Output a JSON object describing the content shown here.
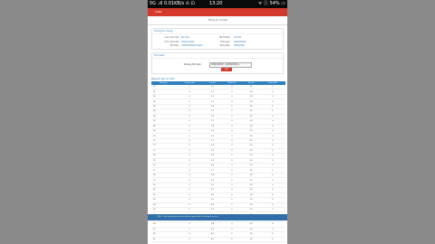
{
  "status": {
    "left": "5G .ıll 0.01KB/s ⊙ ⊡",
    "time": "13:20",
    "right": "ᯤ ⓘ 54% ▭"
  },
  "app": {
    "title": "CSDL"
  },
  "subtitle": "Thông tin chi tiết",
  "info": {
    "title": "Thông tin chung",
    "rows": [
      {
        "k1": "Loại cảm biến:",
        "v1": "Đo mưa",
        "k2": "Mã tỉnh/tp:",
        "v2": "XX XXX"
      },
      {
        "k1": "Vị trí cảm biến:",
        "v1": "XXXXX XXXX",
        "k2": "Thời gian:",
        "v2": "XX/XX/XXXX"
      },
      {
        "k1": "Tên trạm:",
        "v1": "XXXXXXXXXXX XXXX",
        "k2": "Trạng thái:",
        "v2": "XXXXXXXX"
      }
    ]
  },
  "filter": {
    "title": "Tìm kiếm",
    "label": "Khoảng thời gian:",
    "select": "XX/XX/XXXX - XX/XX/XXXX ▾",
    "button": "Lọc"
  },
  "table": {
    "title": "Bảng số liệu chi tiết",
    "headers": [
      "Thời gian",
      "Lượng mưa",
      "Lũy kế",
      "Nhiệt độ",
      "Độ ẩm",
      "Trạng thái"
    ],
    "rows": [
      [
        "00",
        "0",
        "1.0",
        "0",
        "30",
        "0"
      ],
      [
        "01",
        "0",
        "1.1",
        "0",
        "30",
        "0"
      ],
      [
        "02",
        "0",
        "1.2",
        "0",
        "30",
        "0"
      ],
      [
        "03",
        "0",
        "1.3",
        "0",
        "30",
        "0"
      ],
      [
        "04",
        "0",
        "1.4",
        "0",
        "30",
        "0"
      ],
      [
        "05",
        "0",
        "1.5",
        "0",
        "30",
        "0"
      ],
      [
        "06",
        "0",
        "1.6",
        "0",
        "30",
        "0"
      ],
      [
        "07",
        "0",
        "1.7",
        "0",
        "30",
        "0"
      ],
      [
        "08",
        "0",
        "1.8",
        "0",
        "30",
        "0"
      ],
      [
        "09",
        "0",
        "1.9",
        "0",
        "30",
        "0"
      ],
      [
        "10",
        "0",
        "2.0",
        "0",
        "30",
        "0"
      ],
      [
        "11",
        "0",
        "2.1",
        "0",
        "30",
        "0"
      ],
      [
        "12",
        "0",
        "2.2",
        "0",
        "30",
        "0"
      ],
      [
        "13",
        "0",
        "2.3",
        "0",
        "30",
        "0"
      ],
      [
        "14",
        "0",
        "2.4",
        "0",
        "30",
        "0"
      ],
      [
        "15",
        "0",
        "2.5",
        "0",
        "30",
        "0"
      ],
      [
        "16",
        "0",
        "2.6",
        "0",
        "30",
        "0"
      ],
      [
        "17",
        "0",
        "2.7",
        "0",
        "30",
        "0"
      ],
      [
        "18",
        "0",
        "2.8",
        "0",
        "30",
        "0"
      ],
      [
        "19",
        "0",
        "2.9",
        "0",
        "30",
        "0"
      ],
      [
        "20",
        "0",
        "3.0",
        "0",
        "30",
        "0"
      ],
      [
        "21",
        "0",
        "3.1",
        "0",
        "30",
        "0"
      ],
      [
        "22",
        "0",
        "3.2",
        "0",
        "30",
        "0"
      ],
      [
        "23",
        "0",
        "3.3",
        "0",
        "30",
        "0"
      ],
      [
        "24",
        "0",
        "3.4",
        "0",
        "30",
        "0"
      ],
      [
        "25",
        "0",
        "3.5",
        "0",
        "30",
        "0"
      ],
      [
        "26",
        "0",
        "3.6",
        "0",
        "30",
        "0"
      ],
      [
        "27",
        "0",
        "3.7",
        "0",
        "30",
        "0"
      ],
      [
        "28",
        "0",
        "3.8",
        "0",
        "30",
        "0"
      ],
      [
        "29",
        "0",
        "3.9",
        "0",
        "30",
        "0"
      ],
      [
        "30",
        "0",
        "4.0",
        "0",
        "30",
        "0"
      ],
      [
        "31",
        "0",
        "4.1",
        "0",
        "30",
        "0"
      ]
    ]
  },
  "footer": "CSDL - Hệ thống quản lý cơ sở dữ liệu quan trắc khí tượng thủy văn"
}
